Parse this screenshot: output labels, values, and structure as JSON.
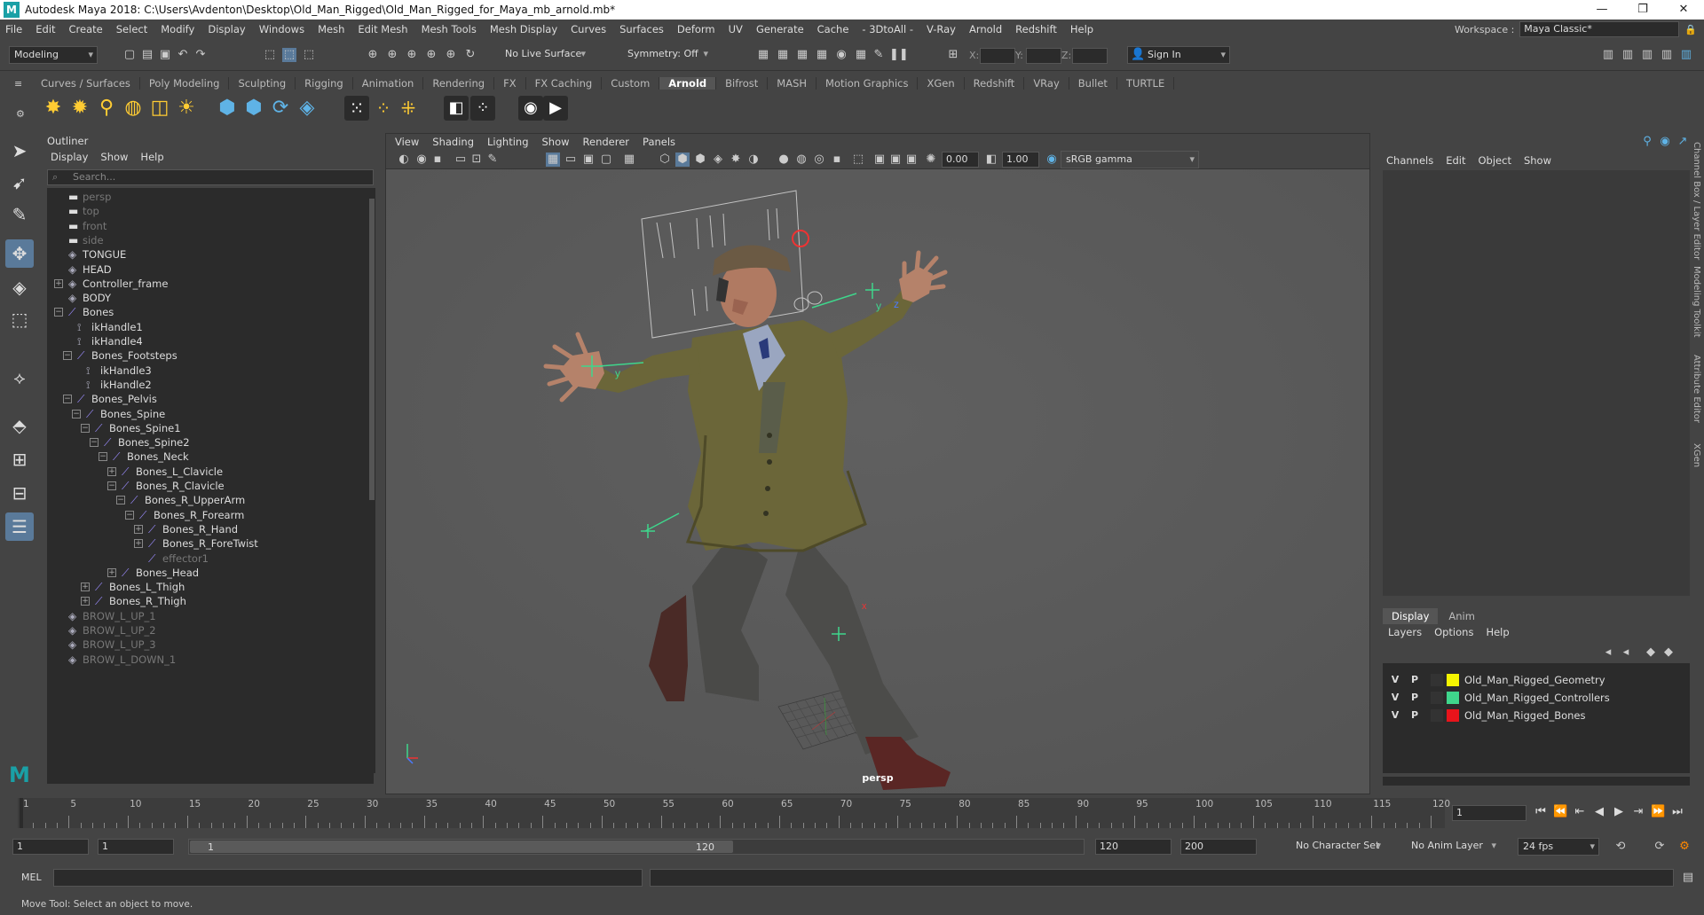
{
  "window": {
    "title": "Autodesk Maya 2018: C:\\Users\\Avdenton\\Desktop\\Old_Man_Rigged\\Old_Man_Rigged_for_Maya_mb_arnold.mb*"
  },
  "menubar": [
    "File",
    "Edit",
    "Create",
    "Select",
    "Modify",
    "Display",
    "Windows",
    "Mesh",
    "Edit Mesh",
    "Mesh Tools",
    "Mesh Display",
    "Curves",
    "Surfaces",
    "Deform",
    "UV",
    "Generate",
    "Cache",
    "- 3DtoAll -",
    "V-Ray",
    "Arnold",
    "Redshift",
    "Help"
  ],
  "workspace": {
    "label": "Workspace :",
    "value": "Maya Classic*"
  },
  "statusline": {
    "mode": "Modeling",
    "live_surface": "No Live Surface",
    "symmetry": "Symmetry: Off",
    "x_label": "X:",
    "y_label": "Y:",
    "z_label": "Z:",
    "sign_in": "Sign In"
  },
  "shelf_tabs": [
    "Curves / Surfaces",
    "Poly Modeling",
    "Sculpting",
    "Rigging",
    "Animation",
    "Rendering",
    "FX",
    "FX Caching",
    "Custom",
    "Arnold",
    "Bifrost",
    "MASH",
    "Motion Graphics",
    "XGen",
    "Redshift",
    "VRay",
    "Bullet",
    "TURTLE"
  ],
  "shelf_active": "Arnold",
  "outliner": {
    "title": "Outliner",
    "menu": [
      "Display",
      "Show",
      "Help"
    ],
    "search_placeholder": "Search...",
    "rows": [
      {
        "label": "persp",
        "icon": "camera-icon",
        "depth": 0,
        "dim": true
      },
      {
        "label": "top",
        "icon": "camera-icon",
        "depth": 0,
        "dim": true
      },
      {
        "label": "front",
        "icon": "camera-icon",
        "depth": 0,
        "dim": true
      },
      {
        "label": "side",
        "icon": "camera-icon",
        "depth": 0,
        "dim": true
      },
      {
        "label": "TONGUE",
        "icon": "group-icon",
        "depth": 0
      },
      {
        "label": "HEAD",
        "icon": "group-icon",
        "depth": 0
      },
      {
        "label": "Controller_frame",
        "icon": "group-icon",
        "depth": 0,
        "exp": "+"
      },
      {
        "label": "BODY",
        "icon": "group-icon",
        "depth": 0
      },
      {
        "label": "Bones",
        "icon": "joint-icon",
        "depth": 0,
        "exp": "-"
      },
      {
        "label": "ikHandle1",
        "icon": "ikhandle-icon",
        "depth": 1
      },
      {
        "label": "ikHandle4",
        "icon": "ikhandle-icon",
        "depth": 1
      },
      {
        "label": "Bones_Footsteps",
        "icon": "joint-icon",
        "depth": 1,
        "exp": "-"
      },
      {
        "label": "ikHandle3",
        "icon": "ikhandle-icon",
        "depth": 2
      },
      {
        "label": "ikHandle2",
        "icon": "ikhandle-icon",
        "depth": 2
      },
      {
        "label": "Bones_Pelvis",
        "icon": "joint-icon",
        "depth": 1,
        "exp": "-"
      },
      {
        "label": "Bones_Spine",
        "icon": "joint-icon",
        "depth": 2,
        "exp": "-"
      },
      {
        "label": "Bones_Spine1",
        "icon": "joint-icon",
        "depth": 3,
        "exp": "-"
      },
      {
        "label": "Bones_Spine2",
        "icon": "joint-icon",
        "depth": 4,
        "exp": "-"
      },
      {
        "label": "Bones_Neck",
        "icon": "joint-icon",
        "depth": 5,
        "exp": "-"
      },
      {
        "label": "Bones_L_Clavicle",
        "icon": "joint-icon",
        "depth": 6,
        "exp": "+"
      },
      {
        "label": "Bones_R_Clavicle",
        "icon": "joint-icon",
        "depth": 6,
        "exp": "-"
      },
      {
        "label": "Bones_R_UpperArm",
        "icon": "joint-icon",
        "depth": 7,
        "exp": "-"
      },
      {
        "label": "Bones_R_Forearm",
        "icon": "joint-icon",
        "depth": 8,
        "exp": "-"
      },
      {
        "label": "Bones_R_Hand",
        "icon": "joint-icon",
        "depth": 9,
        "exp": "+"
      },
      {
        "label": "Bones_R_ForeTwist",
        "icon": "joint-icon",
        "depth": 9,
        "exp": "+"
      },
      {
        "label": "effector1",
        "icon": "effector-icon",
        "depth": 9,
        "dim": true
      },
      {
        "label": "Bones_Head",
        "icon": "joint-icon",
        "depth": 6,
        "exp": "+"
      },
      {
        "label": "Bones_L_Thigh",
        "icon": "joint-icon",
        "depth": 3,
        "exp": "+"
      },
      {
        "label": "Bones_R_Thigh",
        "icon": "joint-icon",
        "depth": 3,
        "exp": "+"
      },
      {
        "label": "BROW_L_UP_1",
        "icon": "group-icon",
        "depth": 0,
        "dim": true
      },
      {
        "label": "BROW_L_UP_2",
        "icon": "group-icon",
        "depth": 0,
        "dim": true
      },
      {
        "label": "BROW_L_UP_3",
        "icon": "group-icon",
        "depth": 0,
        "dim": true
      },
      {
        "label": "BROW_L_DOWN_1",
        "icon": "group-icon",
        "depth": 0,
        "dim": true
      }
    ]
  },
  "viewport": {
    "menu": [
      "View",
      "Shading",
      "Lighting",
      "Show",
      "Renderer",
      "Panels"
    ],
    "field1": "0.00",
    "field2": "1.00",
    "colorspace": "sRGB gamma",
    "camera_label": "persp"
  },
  "channelbox": {
    "menu": [
      "Channels",
      "Edit",
      "Object",
      "Show"
    ],
    "layer_tabs": [
      "Display",
      "Anim"
    ],
    "layer_menu": [
      "Layers",
      "Options",
      "Help"
    ],
    "layers": [
      {
        "v": "V",
        "p": "P",
        "name": "Old_Man_Rigged_Geometry",
        "color": "#f5f500"
      },
      {
        "v": "V",
        "p": "P",
        "name": "Old_Man_Rigged_Controllers",
        "color": "#3fd68c"
      },
      {
        "v": "V",
        "p": "P",
        "name": "Old_Man_Rigged_Bones",
        "color": "#e8141b"
      }
    ]
  },
  "side_tabs": [
    "Channel Box / Layer Editor",
    "Modeling Toolkit",
    "Attribute Editor",
    "XGen"
  ],
  "timeline": {
    "ticks": [
      1,
      5,
      10,
      15,
      20,
      25,
      30,
      35,
      40,
      45,
      50,
      55,
      60,
      65,
      70,
      75,
      80,
      85,
      90,
      95,
      100,
      105,
      110,
      115,
      120
    ],
    "current_frame": "1"
  },
  "range": {
    "start": "1",
    "anim_start": "1",
    "range_start": "1",
    "range_end": "120",
    "end": "120",
    "anim_end": "200",
    "character_set": "No Character Set",
    "anim_layer": "No Anim Layer",
    "fps": "24 fps"
  },
  "cmdline": {
    "label": "MEL"
  },
  "helpline": {
    "text": "Move Tool: Select an object to move."
  }
}
